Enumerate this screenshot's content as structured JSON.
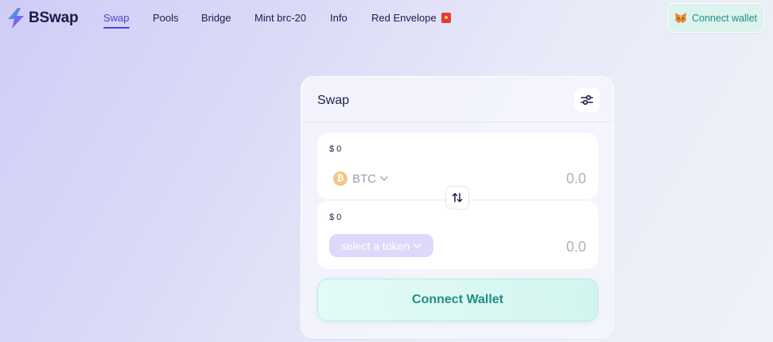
{
  "header": {
    "logo_text": "BSwap",
    "nav": [
      {
        "label": "Swap",
        "active": true
      },
      {
        "label": "Pools",
        "active": false
      },
      {
        "label": "Bridge",
        "active": false
      },
      {
        "label": "Mint brc-20",
        "active": false
      },
      {
        "label": "Info",
        "active": false
      },
      {
        "label": "Red Envelope",
        "active": false,
        "icon": "red-envelope-icon"
      }
    ],
    "connect_wallet_label": "Connect wallet",
    "connect_wallet_icon": "metamask-fox-icon"
  },
  "swap_card": {
    "title": "Swap",
    "settings_icon": "sliders-icon",
    "from": {
      "usd_value": "$ 0",
      "token": "BTC",
      "token_icon": "bitcoin-icon",
      "amount": "0.0"
    },
    "switch_icon": "swap-arrows-icon",
    "to": {
      "usd_value": "$ 0",
      "select_token_label": "select a token",
      "amount": "0.0"
    },
    "connect_wallet_label": "Connect Wallet"
  },
  "colors": {
    "accent": "#4b45c9",
    "teal": "#1f8e84",
    "btc": "#f5c483",
    "select_token_bg": "#dcd9fa"
  }
}
